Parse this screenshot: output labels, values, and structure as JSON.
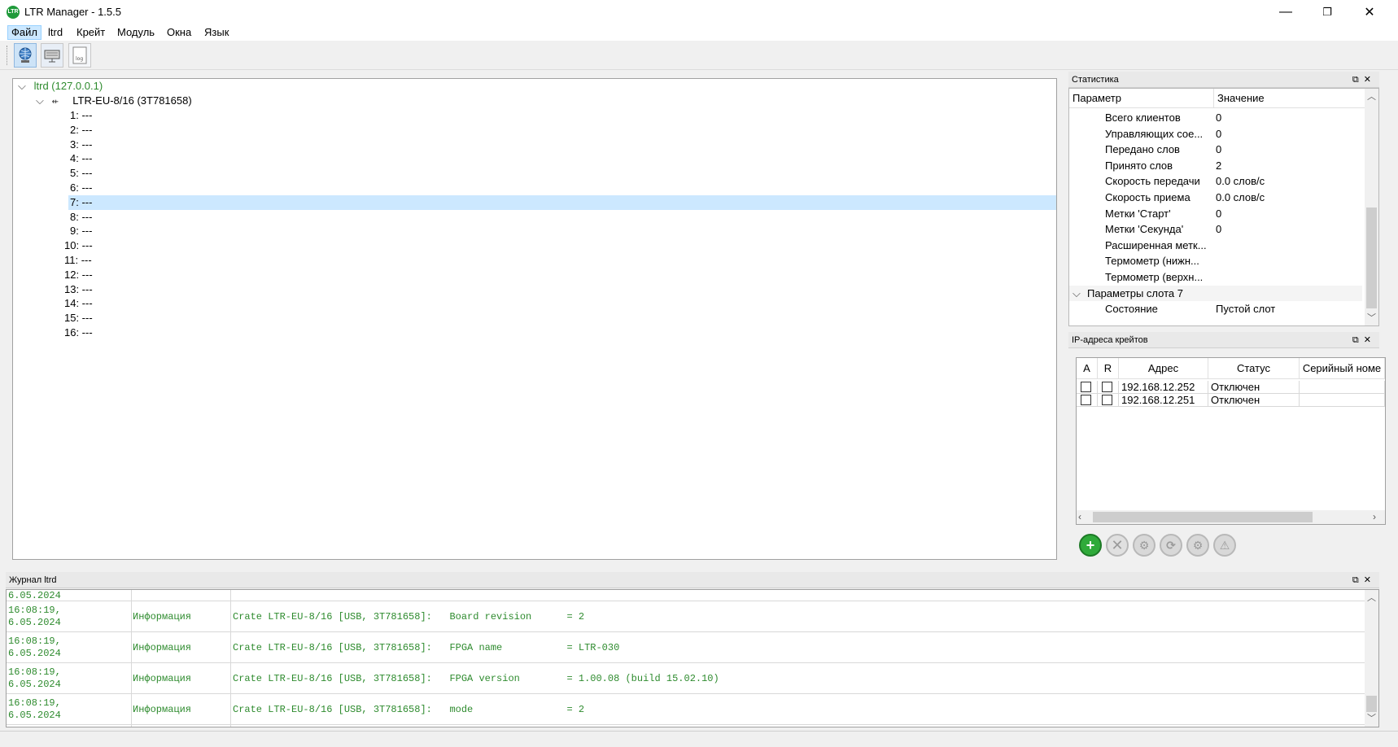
{
  "window": {
    "icon_text": "LTR",
    "title": "LTR Manager - 1.5.5",
    "minimize": "—",
    "maximize": "❐",
    "close": "✕"
  },
  "menu": [
    {
      "label": "Файл"
    },
    {
      "label": "ltrd"
    },
    {
      "label": "Крейт"
    },
    {
      "label": "Модуль"
    },
    {
      "label": "Окна"
    },
    {
      "label": "Язык"
    }
  ],
  "toolbar": {
    "buttons": [
      {
        "icon": "network-globe-icon"
      },
      {
        "icon": "crate-icon"
      },
      {
        "icon": "log-icon",
        "text": "log"
      }
    ]
  },
  "tree": {
    "root": "ltrd (127.0.0.1)",
    "crate": "LTR-EU-8/16 (3T781658)",
    "slots": [
      "1: ---",
      "2: ---",
      "3: ---",
      "4: ---",
      "5: ---",
      "6: ---",
      "7: ---",
      "8: ---",
      "9: ---",
      "10: ---",
      "11: ---",
      "12: ---",
      "13: ---",
      "14: ---",
      "15: ---",
      "16: ---"
    ],
    "selected_slot": 7
  },
  "stats": {
    "title": "Статистика",
    "col_param": "Параметр",
    "col_value": "Значение",
    "rows": [
      {
        "name": "Всего клиентов",
        "value": "0"
      },
      {
        "name": "Управляющих сое...",
        "value": "0"
      },
      {
        "name": "Передано слов",
        "value": "0"
      },
      {
        "name": "Принято слов",
        "value": "2"
      },
      {
        "name": "Скорость передачи",
        "value": "0.0 слов/с"
      },
      {
        "name": "Скорость приема",
        "value": "0.0 слов/с"
      },
      {
        "name": "Метки 'Старт'",
        "value": "0"
      },
      {
        "name": "Метки 'Секунда'",
        "value": "0"
      },
      {
        "name": "Расширенная метк...",
        "value": ""
      },
      {
        "name": "Термометр (нижн...",
        "value": ""
      },
      {
        "name": "Термометр (верхн...",
        "value": ""
      }
    ],
    "group": "Параметры слота 7",
    "group_rows": [
      {
        "name": "Состояние",
        "value": "Пустой слот"
      }
    ]
  },
  "ip": {
    "title": "IP-адреса крейтов",
    "headers": {
      "a": "A",
      "r": "R",
      "address": "Адрес",
      "status": "Статус",
      "serial": "Серийный номе"
    },
    "rows": [
      {
        "address": "192.168.12.252",
        "status": "Отключен",
        "serial": ""
      },
      {
        "address": "192.168.12.251",
        "status": "Отключен",
        "serial": ""
      }
    ],
    "buttons": [
      "add-icon",
      "remove-icon",
      "connect-icon",
      "refresh-icon",
      "settings-icon",
      "disconnect-icon"
    ]
  },
  "log": {
    "title": "Журнал ltrd",
    "rows": [
      {
        "time": "16:08:19,\n6.05.2024",
        "level": "Информация",
        "message": "Crate LTR-EU-8/16 [USB, 3T781658]:   Board revision      = 2"
      },
      {
        "time": "16:08:19,\n6.05.2024",
        "level": "Информация",
        "message": "Crate LTR-EU-8/16 [USB, 3T781658]:   FPGA name           = LTR-030"
      },
      {
        "time": "16:08:19,\n6.05.2024",
        "level": "Информация",
        "message": "Crate LTR-EU-8/16 [USB, 3T781658]:   FPGA version        = 1.00.08 (build 15.02.10)"
      },
      {
        "time": "16:08:19,\n6.05.2024",
        "level": "Информация",
        "message": "Crate LTR-EU-8/16 [USB, 3T781658]:   mode                = 2"
      }
    ],
    "partial_top_date": "6.05.2024"
  },
  "colors": {
    "accent": "#2e8b2e",
    "selection": "#cce8ff"
  }
}
